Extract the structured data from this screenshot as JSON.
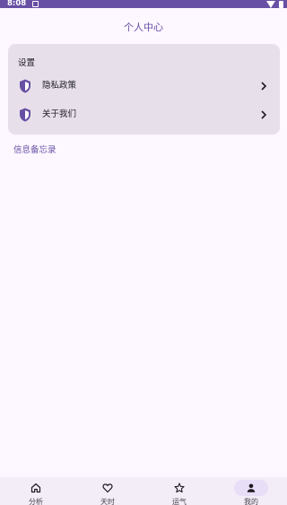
{
  "status": {
    "time": "8:08",
    "notif_icon": "notification-icon",
    "wifi_icon": "wifi-icon",
    "battery_icon": "battery-icon"
  },
  "page": {
    "title": "个人中心"
  },
  "settings": {
    "heading": "设置",
    "items": [
      {
        "label": "隐私政策",
        "icon": "shield-icon"
      },
      {
        "label": "关于我们",
        "icon": "shield-icon"
      }
    ]
  },
  "links": {
    "info_memo": "信息备忘录"
  },
  "nav": {
    "items": [
      {
        "label": "分析",
        "icon": "home-icon",
        "active": false
      },
      {
        "label": "天时",
        "icon": "heart-icon",
        "active": false
      },
      {
        "label": "运气",
        "icon": "star-icon",
        "active": false
      },
      {
        "label": "我的",
        "icon": "person-icon",
        "active": true
      }
    ]
  },
  "colors": {
    "primary": "#6750a4",
    "background": "#fdf7ff",
    "card": "#e7e0eb",
    "nav_bg": "#f3edf7",
    "nav_indicator": "#e8def8"
  }
}
